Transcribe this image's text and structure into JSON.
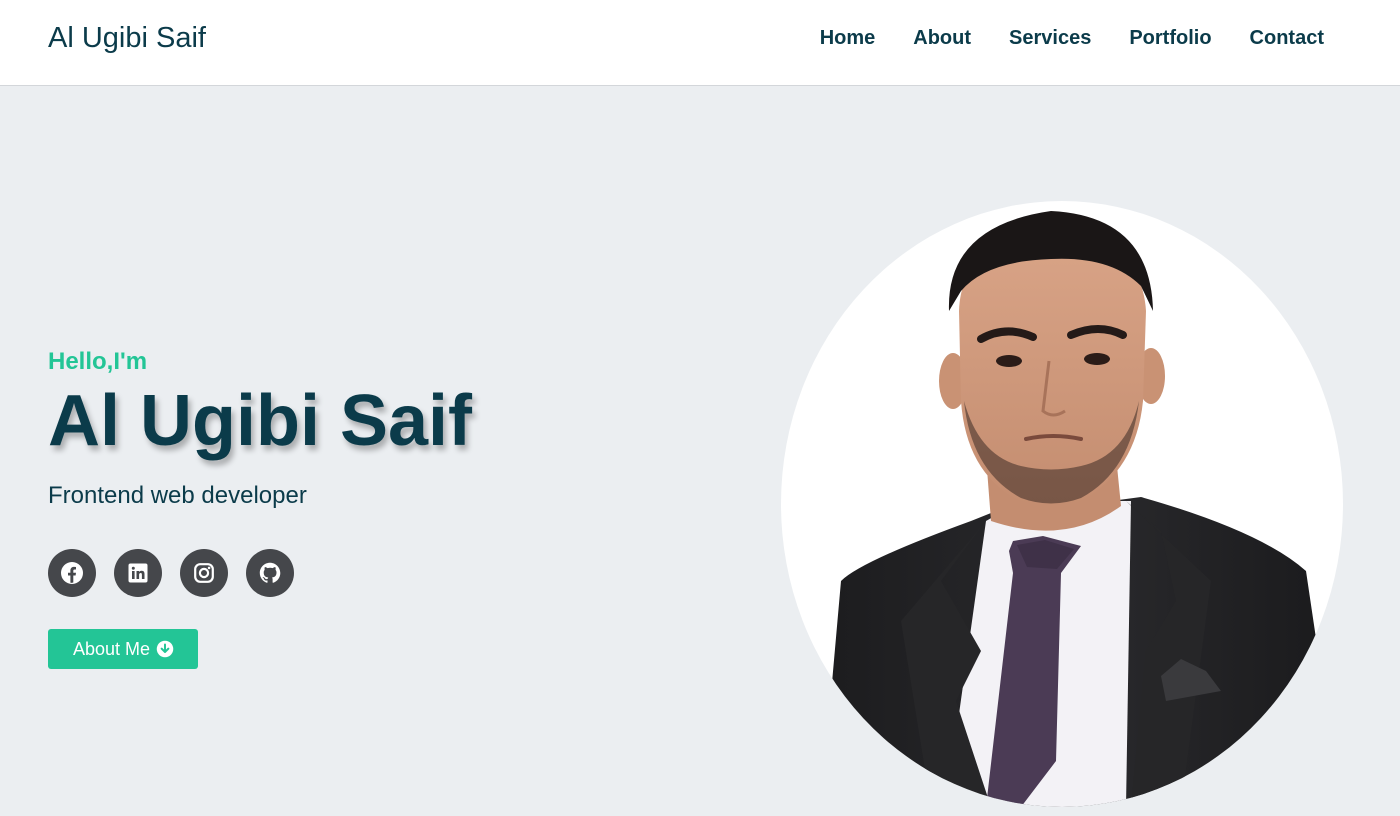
{
  "header": {
    "brand": "Al Ugibi Saif",
    "nav": [
      {
        "label": "Home"
      },
      {
        "label": "About"
      },
      {
        "label": "Services"
      },
      {
        "label": "Portfolio"
      },
      {
        "label": "Contact"
      }
    ]
  },
  "hero": {
    "greeting": "Hello,I'm",
    "name": "Al Ugibi Saif",
    "role": "Frontend web developer",
    "socials": [
      {
        "icon": "facebook-icon"
      },
      {
        "icon": "linkedin-icon"
      },
      {
        "icon": "instagram-icon"
      },
      {
        "icon": "github-icon"
      }
    ],
    "cta_label": "About Me",
    "cta_icon": "arrow-circle-down-icon"
  },
  "colors": {
    "primary": "#0b3b4a",
    "accent": "#23c596",
    "background": "#ebeef1",
    "header_bg": "#ffffff",
    "social_bg": "#45474b"
  }
}
